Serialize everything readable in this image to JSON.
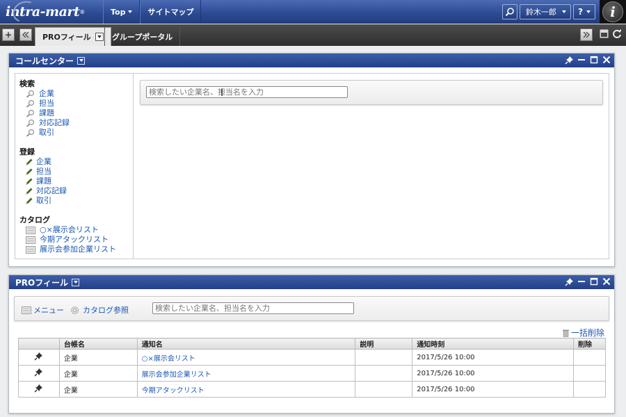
{
  "header": {
    "logo": "intra-mart",
    "logo_reg": "®",
    "nav": [
      {
        "label": "Top",
        "has_caret": true
      },
      {
        "label": "サイトマップ",
        "has_caret": false
      }
    ],
    "user_name": "鈴木一郎",
    "help_label": "?",
    "brand_letter": "i"
  },
  "tabbar": {
    "add_label": "+",
    "tabs": [
      {
        "label": "PROフィール",
        "active": true
      },
      {
        "label": "グループポータル",
        "active": false
      }
    ]
  },
  "call_center": {
    "title": "コールセンター",
    "search_section": {
      "title": "検索",
      "items": [
        "企業",
        "担当",
        "課題",
        "対応記録",
        "取引"
      ]
    },
    "register_section": {
      "title": "登録",
      "items": [
        "企業",
        "担当",
        "課題",
        "対応記録",
        "取引"
      ]
    },
    "catalog_section": {
      "title": "カタログ",
      "items": [
        "○×展示会リスト",
        "今期アタックリスト",
        "展示会参加企業リスト"
      ]
    },
    "search_placeholder": "検索したい企業名、担当名を入力"
  },
  "profile": {
    "title": "PROフィール",
    "menu_label": "メニュー",
    "catalog_ref_label": "カタログ参照",
    "search_placeholder": "検索したい企業名、担当名を入力",
    "bulk_delete_label": "一括削除",
    "table": {
      "columns": [
        "",
        "台帳名",
        "通知名",
        "説明",
        "通知時刻",
        "削除"
      ],
      "rows": [
        {
          "ledger": "企業",
          "name": "○×展示会リスト",
          "desc": "",
          "time": "2017/5/26 10:00"
        },
        {
          "ledger": "企業",
          "name": "展示会参加企業リスト",
          "desc": "",
          "time": "2017/5/26 10:00"
        },
        {
          "ledger": "企業",
          "name": "今期アタックリスト",
          "desc": "",
          "time": "2017/5/26 10:00"
        }
      ]
    }
  },
  "colors": {
    "header_blue": "#2b4a91",
    "link_blue": "#1a56b4",
    "tabbar_dark": "#3a3a3a"
  }
}
